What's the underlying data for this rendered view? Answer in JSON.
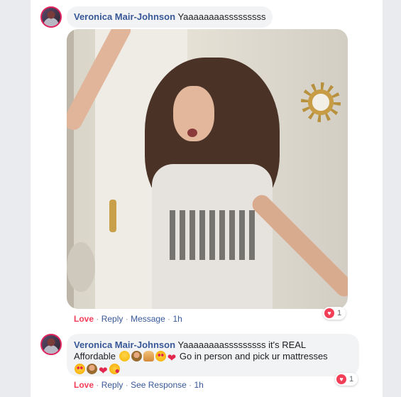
{
  "comments": [
    {
      "author": "Veronica Mair-Johnson",
      "text": "Yaaaaaaaasssssssss",
      "actions": {
        "reaction": "Love",
        "reply": "Reply",
        "extra": "Message",
        "time": "1h"
      },
      "reaction_count": "1"
    },
    {
      "author": "Veronica Mair-Johnson",
      "text_line1": "Yaaaaaaaasssssssss it's REAL",
      "text_line2a": "Affordable",
      "text_line2b": "Go in person and pick ur mattresses",
      "actions": {
        "reaction": "Love",
        "reply": "Reply",
        "extra": "See Response",
        "time": "1h"
      },
      "reaction_count": "1"
    }
  ],
  "separator": "·",
  "icons": {
    "avatar": "avatar-image",
    "reaction": "love-heart-icon",
    "emoji_line2": [
      "relieved-face",
      "woman-emoji",
      "folded-hands",
      "heart-eyes",
      "red-heart"
    ],
    "emoji_line3": [
      "heart-eyes",
      "woman-emoji",
      "red-heart",
      "face-blowing-kiss"
    ]
  },
  "colors": {
    "author": "#385898",
    "love": "#f33e58",
    "bubble": "#f2f3f5",
    "meta": "#90949c"
  }
}
